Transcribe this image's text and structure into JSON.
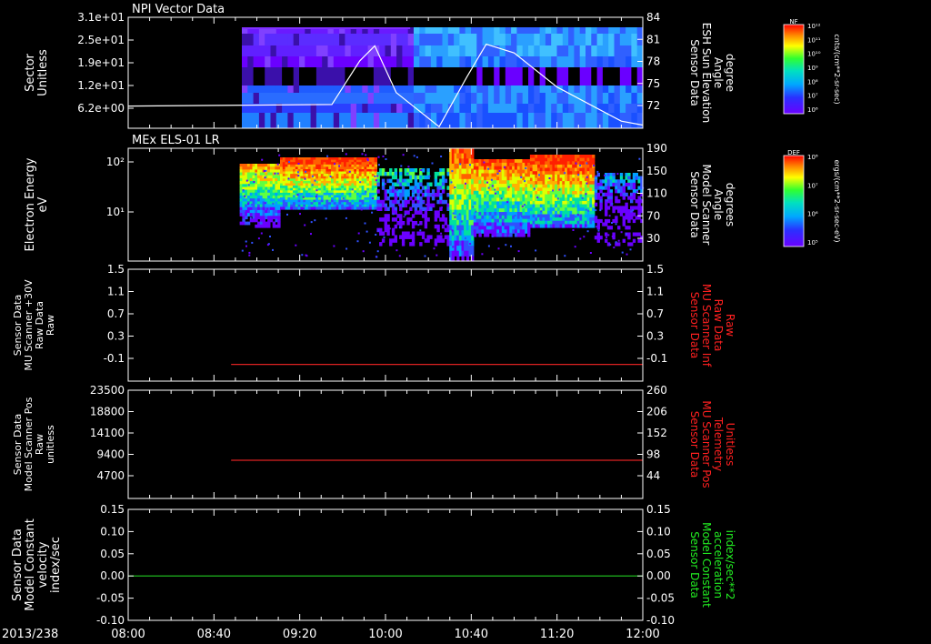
{
  "figure": {
    "date_label": "2013/238",
    "time_ticks": [
      "08:00",
      "08:40",
      "09:20",
      "10:00",
      "10:40",
      "11:20",
      "12:00"
    ]
  },
  "chart_data": [
    {
      "type": "heatmap",
      "title": "NPI Vector Data",
      "ylabel_left": [
        "Sector",
        "Unitless"
      ],
      "left_ticks": [
        "3.1e+01",
        "2.5e+01",
        "1.9e+01",
        "1.2e+01",
        "6.2e+00"
      ],
      "right_ticks": [
        "84",
        "81",
        "78",
        "75",
        "72"
      ],
      "ylabel_right": [
        "Sensor Data",
        "ESH Sun Elevation",
        "Angle",
        "degree"
      ],
      "colorbar": {
        "label": "NF",
        "ticks": [
          "10¹²",
          "10¹¹",
          "10¹⁰",
          "10⁹",
          "10⁸",
          "10⁷",
          "10⁶"
        ],
        "units": "cnts/(cm**2-sr-sec)"
      },
      "data_start": "08:53",
      "sun_elevation_curve": {
        "x": [
          "08:00",
          "09:35",
          "09:48",
          "09:55",
          "10:05",
          "10:25",
          "10:38",
          "10:47",
          "11:00",
          "11:20",
          "11:50",
          "12:00"
        ],
        "y": [
          72.8,
          73.0,
          78.5,
          80.4,
          74.5,
          70.2,
          76.5,
          80.6,
          79.5,
          75.2,
          70.9,
          70.4
        ]
      }
    },
    {
      "type": "heatmap",
      "title": "MEx ELS-01 LR",
      "ylabel_left": [
        "Electron Energy",
        "eV"
      ],
      "left_ticks": [
        "10²",
        "10¹"
      ],
      "right_ticks": [
        "190",
        "150",
        "110",
        "70",
        "30"
      ],
      "ylabel_right": [
        "Sensor Data",
        "Model Scanner",
        "Angle",
        "degrees"
      ],
      "colorbar": {
        "label": "DEF",
        "ticks": [
          "10⁸",
          "10⁷",
          "10⁶",
          "10⁵"
        ],
        "units": "ergs/(cm**2-sr-sec-eV)"
      },
      "data_start": "08:52",
      "scanner_angle_level": 10
    },
    {
      "type": "line",
      "ylabel_left": [
        "Sensor Data",
        "MU Scanner +30V",
        "Raw Data",
        "Raw"
      ],
      "left_ticks": [
        "1.5",
        "1.1",
        "0.7",
        "0.3",
        "-0.1"
      ],
      "right_ticks": [
        "1.5",
        "1.1",
        "0.7",
        "0.3",
        "-0.1"
      ],
      "ylabel_right": [
        "Sensor Data",
        "MU Scanner Inf",
        "Raw Data",
        "Raw"
      ],
      "ylim": [
        -0.3,
        1.5
      ],
      "series": [
        {
          "color": "#dd2222",
          "x": [
            "08:48",
            "12:00"
          ],
          "y": [
            -0.03,
            -0.03
          ]
        }
      ]
    },
    {
      "type": "line",
      "ylabel_left": [
        "Sensor Data",
        "Model Scanner Pos",
        "Raw",
        "unitless"
      ],
      "left_ticks": [
        "23500",
        "18800",
        "14100",
        "9400",
        "4700"
      ],
      "right_ticks": [
        "260",
        "206",
        "152",
        "98",
        "44"
      ],
      "ylabel_right": [
        "Sensor Data",
        "MU Scanner Pos",
        "Telemetry",
        "Unitless"
      ],
      "ylim": [
        0,
        23500
      ],
      "series": [
        {
          "color": "#dd2222",
          "x": [
            "08:48",
            "12:00"
          ],
          "y": [
            8300,
            8300
          ]
        }
      ]
    },
    {
      "type": "line",
      "ylabel_left": [
        "Sensor Data",
        "Model Constant",
        "velocity",
        "index/sec"
      ],
      "left_ticks": [
        "0.15",
        "0.10",
        "0.05",
        "0.00",
        "-0.05",
        "-0.10"
      ],
      "right_ticks": [
        "0.15",
        "0.10",
        "0.05",
        "0.00",
        "-0.05",
        "-0.10"
      ],
      "ylabel_right": [
        "Sensor Data",
        "Model Constant",
        "acceleration",
        "index/sec**2"
      ],
      "ylim": [
        -0.1,
        0.15
      ],
      "series": [
        {
          "color": "#22cc22",
          "x": [
            "08:00",
            "12:00"
          ],
          "y": [
            0,
            0
          ]
        }
      ]
    }
  ]
}
